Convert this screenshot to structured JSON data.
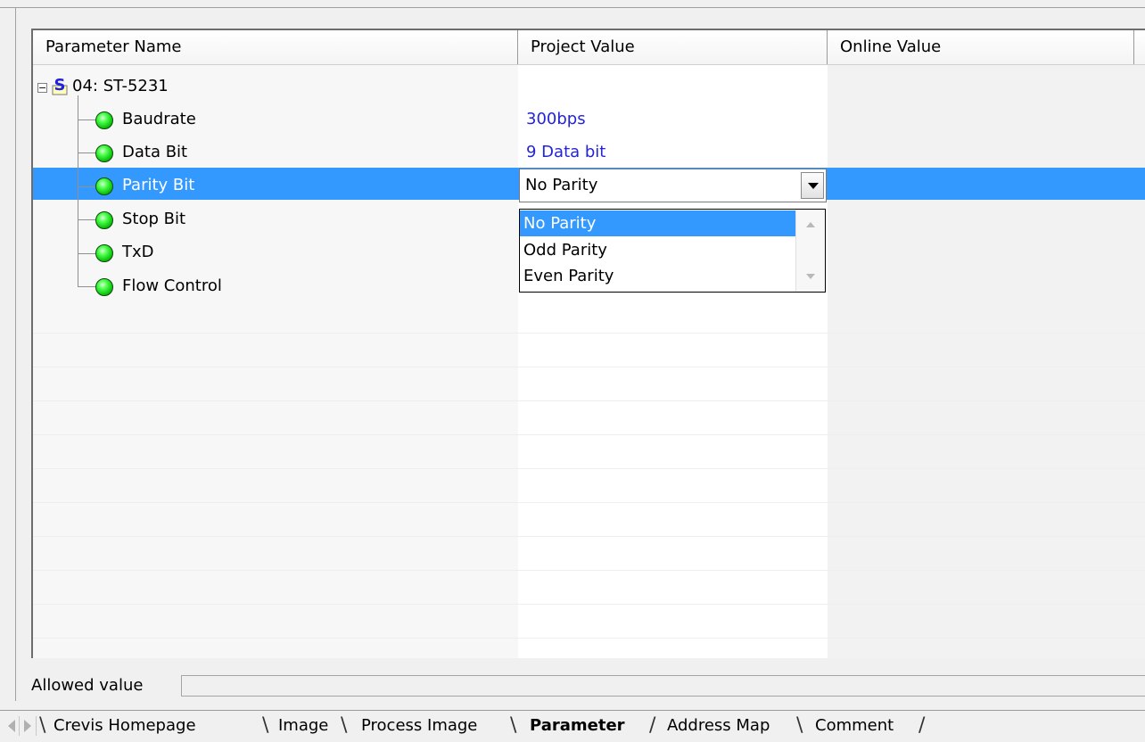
{
  "grid": {
    "columns": [
      "Parameter Name",
      "Project Value",
      "Online Value"
    ],
    "root": {
      "label": "04: ST-5231",
      "icon": "s-module-icon"
    },
    "rows": [
      {
        "name": "Baudrate",
        "project_value": "300bps"
      },
      {
        "name": "Data Bit",
        "project_value": "9 Data bit"
      },
      {
        "name": "Parity Bit",
        "project_value": "No Parity"
      },
      {
        "name": "Stop Bit",
        "project_value": ""
      },
      {
        "name": "TxD",
        "project_value": ""
      },
      {
        "name": "Flow Control",
        "project_value": ""
      }
    ],
    "selected_row": "Parity Bit",
    "combo": {
      "value": "No Parity",
      "options": [
        "No Parity",
        "Odd Parity",
        "Even Parity"
      ],
      "highlighted": "No Parity"
    }
  },
  "allowed_value": {
    "label": "Allowed value",
    "value": ""
  },
  "tabs": [
    {
      "label": "Crevis Homepage",
      "active": false
    },
    {
      "label": "Image",
      "active": false
    },
    {
      "label": "Process Image",
      "active": false
    },
    {
      "label": "Parameter",
      "active": true
    },
    {
      "label": "Address Map",
      "active": false
    },
    {
      "label": "Comment",
      "active": false
    }
  ],
  "colors": {
    "selection": "#3399ff",
    "value_text": "#2424d8",
    "led_green": "#11c911"
  }
}
